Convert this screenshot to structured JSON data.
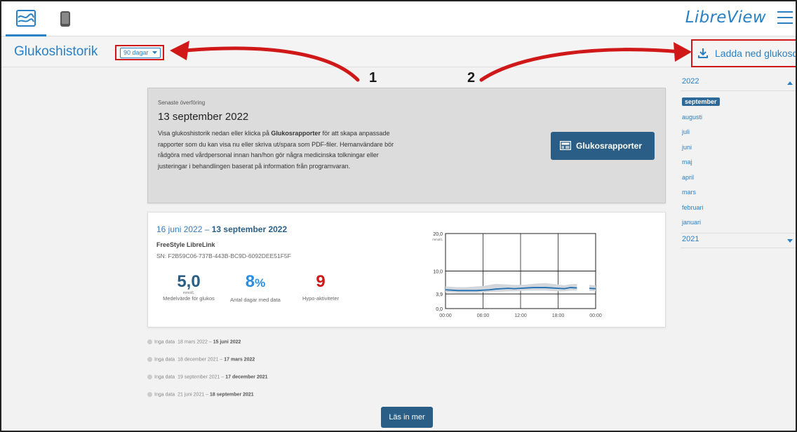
{
  "topbar": {
    "brand": "LibreView"
  },
  "subheader": {
    "title": "Glukoshistorik",
    "range_button": "90 dagar",
    "download_label": "Ladda ned glukosdata"
  },
  "annotations": {
    "first": "1",
    "second": "2"
  },
  "sidebar": {
    "years": [
      {
        "label": "2022",
        "expanded": true
      },
      {
        "label": "2021",
        "expanded": false
      }
    ],
    "months": [
      "september",
      "augusti",
      "juli",
      "juni",
      "maj",
      "april",
      "mars",
      "februari",
      "januari"
    ],
    "selected_month": "september"
  },
  "latest_upload": {
    "label": "Senaste överföring",
    "date": "13 september 2022",
    "text_before": "Visa glukoshistorik nedan eller klicka på ",
    "text_bold": "Glukosrapporter",
    "text_after": " för att skapa anpassade rapporter som du kan visa nu eller skriva ut/spara som PDF-filer. Hemanvändare bör rådgöra med vårdpersonal innan han/hon gör några medicinska tolkningar eller justeringar i behandlingen baserat på information från programvaran.",
    "reports_button": "Glukosrapporter"
  },
  "period": {
    "range_start": "16 juni 2022 –",
    "range_end": "13 september 2022",
    "device": "FreeStyle LibreLink",
    "serial": "SN: F2B59C06-737B-443B-BC9D-6092DEE51F5F",
    "stats": [
      {
        "value": "5,0",
        "unit": "mmol/L",
        "label": "Medelvärde för glukos",
        "color": "#2a5e86"
      },
      {
        "value": "8",
        "suffix": "%",
        "label": "Antal dagar med data",
        "color": "#2a8ee0"
      },
      {
        "value": "9",
        "label": "Hypo-aktiviteter",
        "color": "#d01818"
      }
    ]
  },
  "chart_data": {
    "type": "area",
    "y_ticks": [
      "20,0",
      "10,0",
      "3,9",
      "0,0"
    ],
    "y_unit": "mmol/L",
    "x_ticks": [
      "00:00",
      "06:00",
      "12:00",
      "18:00",
      "00:00"
    ],
    "ylim": [
      0,
      20
    ],
    "target_range": [
      3.9,
      10.0
    ],
    "series": [
      {
        "hours": [
          0,
          1,
          2,
          3,
          4,
          5,
          6,
          7,
          8,
          9,
          10,
          11,
          12,
          13,
          14,
          15,
          16,
          17,
          18,
          19,
          20,
          21,
          22,
          23,
          24
        ],
        "median": [
          5.0,
          4.9,
          4.8,
          4.8,
          4.8,
          4.8,
          4.9,
          5.0,
          5.2,
          5.3,
          5.4,
          5.3,
          5.4,
          5.5,
          5.6,
          5.6,
          5.6,
          5.5,
          5.4,
          5.3,
          5.6,
          5.5,
          null,
          5.4,
          5.3
        ],
        "p10": [
          4.3,
          4.3,
          4.2,
          4.2,
          4.2,
          4.2,
          4.3,
          4.4,
          4.5,
          4.5,
          4.6,
          4.6,
          4.7,
          4.8,
          4.8,
          4.8,
          4.8,
          4.7,
          4.6,
          4.6,
          4.8,
          4.8,
          null,
          4.7,
          4.6
        ],
        "p90": [
          5.9,
          5.8,
          5.7,
          5.7,
          5.8,
          5.9,
          6.0,
          6.3,
          6.6,
          6.5,
          6.4,
          6.3,
          6.3,
          6.4,
          6.6,
          6.7,
          6.8,
          6.6,
          6.4,
          6.2,
          6.5,
          6.6,
          null,
          6.3,
          6.2
        ]
      }
    ],
    "colors": {
      "median": "#1f6fb2",
      "band": "#d3d7dc"
    }
  },
  "no_data": [
    {
      "label": "Inga data",
      "start": "18 mars 2022 –",
      "end": "15 juni 2022"
    },
    {
      "label": "Inga data",
      "start": "18 december 2021 –",
      "end": "17 mars 2022"
    },
    {
      "label": "Inga data",
      "start": "19 september 2021 –",
      "end": "17 december 2021"
    },
    {
      "label": "Inga data",
      "start": "21 juni 2021 –",
      "end": "18 september 2021"
    }
  ],
  "load_more": "Läs in mer"
}
